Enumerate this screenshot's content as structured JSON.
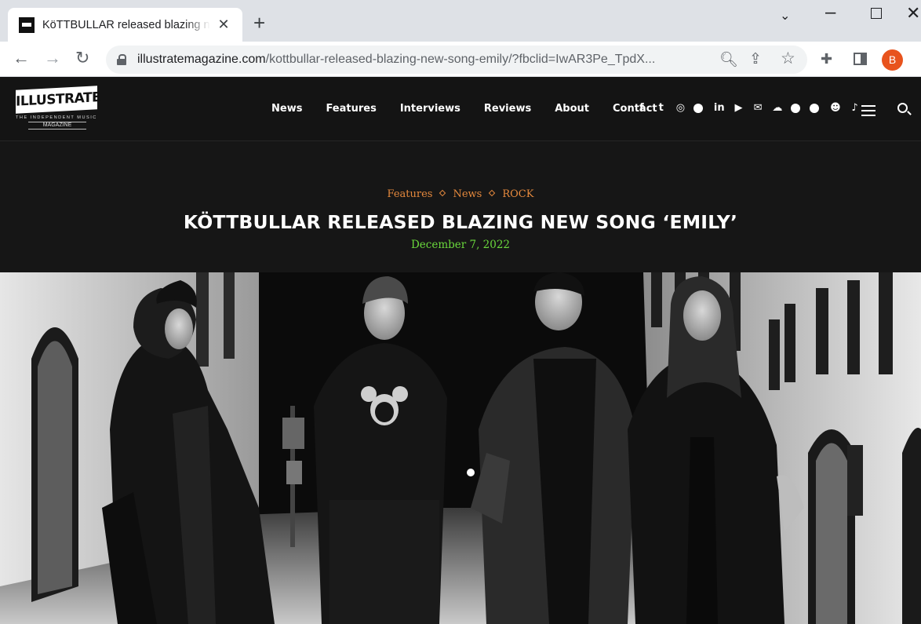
{
  "browser": {
    "tab_title": "KöTTBULLAR released blazing new song 'Emily'",
    "tab_close": "✕",
    "new_tab": "+",
    "url_host": "illustratemagazine.com",
    "url_path": "/kottbullar-released-blazing-new-song-emily/?fbclid=IwAR3Pe_TpdX...",
    "profile_initial": "B"
  },
  "site": {
    "logo_text": "ILLUSTRATE",
    "logo_subtitle": "THE INDEPENDENT MUSIC",
    "logo_magazine": "MAGAZINE",
    "nav": [
      "News",
      "Features",
      "Interviews",
      "Reviews",
      "About",
      "Contact"
    ],
    "social_icons": [
      "facebook-icon",
      "twitter-icon",
      "instagram-icon",
      "pinterest-icon",
      "linkedin-icon",
      "youtube-icon",
      "email-icon",
      "soundcloud-icon",
      "spotify-icon",
      "whatsapp-icon",
      "reddit-icon",
      "tiktok-icon"
    ]
  },
  "article": {
    "categories": [
      "Features",
      "News",
      "ROCK"
    ],
    "title": "KÖTTBULLAR RELEASED BLAZING NEW SONG ‘EMILY’",
    "date": "December 7, 2022"
  },
  "colors": {
    "category": "#e5893d",
    "date": "#6ad83c",
    "header_bg": "#141414",
    "profile": "#e8531d"
  }
}
